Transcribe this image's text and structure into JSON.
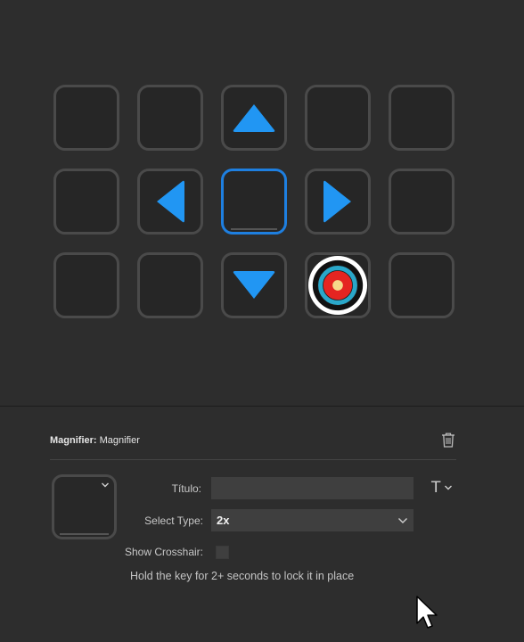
{
  "keys": [
    {
      "icon": "empty"
    },
    {
      "icon": "empty"
    },
    {
      "icon": "arrow-up-icon"
    },
    {
      "icon": "empty"
    },
    {
      "icon": "empty"
    },
    {
      "icon": "empty"
    },
    {
      "icon": "arrow-left-icon"
    },
    {
      "icon": "empty",
      "selected": true
    },
    {
      "icon": "arrow-right-icon"
    },
    {
      "icon": "empty"
    },
    {
      "icon": "empty"
    },
    {
      "icon": "empty"
    },
    {
      "icon": "arrow-down-icon"
    },
    {
      "icon": "target-icon"
    },
    {
      "icon": "empty"
    }
  ],
  "colors": {
    "accent": "#2196f3",
    "selected_border": "#1e7fe0",
    "key_border": "#4a4a4a",
    "background": "#2d2d2d"
  },
  "inspector": {
    "plugin_name": "Magnifier:",
    "action_name": "Magnifier",
    "title_label": "Título:",
    "title_value": "",
    "select_type_label": "Select Type:",
    "select_type_value": "2x",
    "crosshair_label": "Show Crosshair:",
    "crosshair_checked": false,
    "hint": "Hold the key for 2+ seconds to lock it in place",
    "title_style_glyph": "T"
  }
}
